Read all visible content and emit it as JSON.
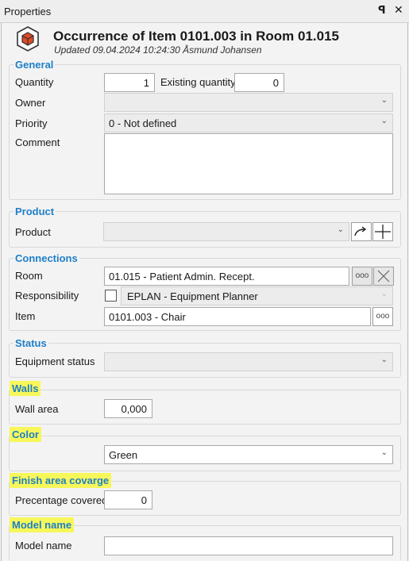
{
  "window": {
    "title": "Properties",
    "pin_icon": "pin-icon",
    "close_icon": "close-icon"
  },
  "header": {
    "title": "Occurrence of Item 0101.003 in Room 01.015",
    "subtitle": "Updated 09.04.2024 10:24:30 Åsmund Johansen",
    "icon": "cube-icon"
  },
  "general": {
    "legend": "General",
    "quantity_label": "Quantity",
    "quantity_value": "1",
    "existing_quantity_label": "Existing quantity",
    "existing_quantity_value": "0",
    "owner_label": "Owner",
    "owner_value": "",
    "priority_label": "Priority",
    "priority_value": "0 - Not defined",
    "comment_label": "Comment",
    "comment_value": ""
  },
  "product": {
    "legend": "Product",
    "product_label": "Product",
    "product_value": "",
    "buttons": [
      "go-to-arrow-icon",
      "add-plus-icon"
    ]
  },
  "connections": {
    "legend": "Connections",
    "room_label": "Room",
    "room_value": "01.015 - Patient Admin. Recept.",
    "responsibility_label": "Responsibility",
    "responsibility_checked": false,
    "responsibility_value": "EPLAN - Equipment Planner",
    "item_label": "Item",
    "item_value": "0101.003 - Chair",
    "browse_label": "ooo"
  },
  "status": {
    "legend": "Status",
    "equipment_status_label": "Equipment status",
    "equipment_status_value": ""
  },
  "walls": {
    "legend": "Walls",
    "wall_area_label": "Wall area",
    "wall_area_value": "0,000"
  },
  "color": {
    "legend": "Color",
    "color_value": "Green"
  },
  "finish": {
    "legend": "Finish area covarge",
    "percentage_label": "Precentage covered",
    "percentage_value": "0"
  },
  "model": {
    "legend": "Model name",
    "model_name_label": "Model name",
    "model_name_value": ""
  },
  "colors": {
    "accent_blue": "#1e7fc8",
    "highlight_yellow": "#f7f75a",
    "legend_default": "#1e7fc8"
  }
}
